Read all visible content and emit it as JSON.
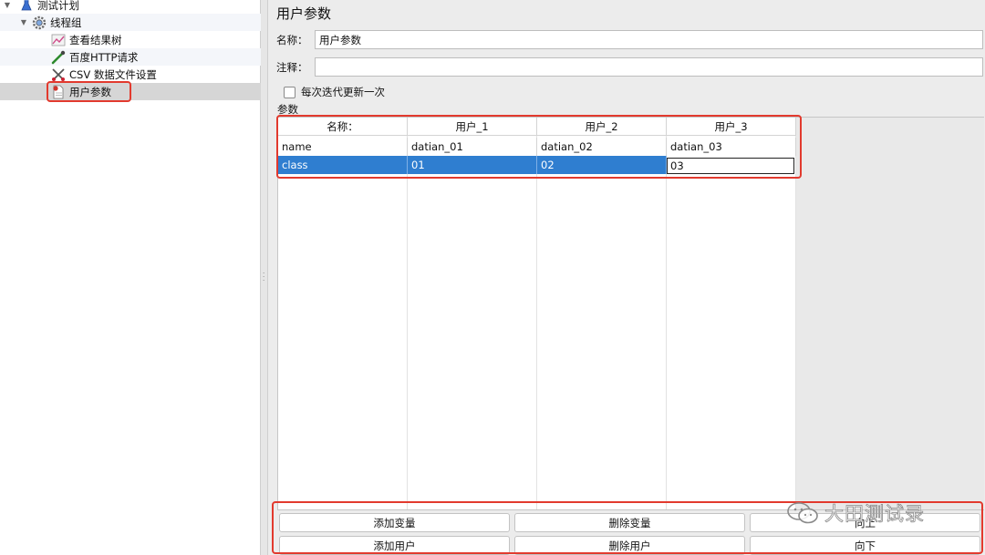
{
  "tree": {
    "items": [
      {
        "label": "测试计划",
        "icon": "flask-icon"
      },
      {
        "label": "线程组",
        "icon": "gear-icon"
      },
      {
        "label": "查看结果树",
        "icon": "chart-icon"
      },
      {
        "label": "百度HTTP请求",
        "icon": "pipette-icon"
      },
      {
        "label": "CSV 数据文件设置",
        "icon": "scissors-icon"
      },
      {
        "label": "用户参数",
        "icon": "document-icon"
      }
    ]
  },
  "form": {
    "title": "用户参数",
    "name_label": "名称：",
    "name_value": "用户参数",
    "comment_label": "注释：",
    "comment_value": "",
    "checkbox_label": "每次迭代更新一次",
    "params_label": "参数"
  },
  "table": {
    "headers": [
      "名称：",
      "用户_1",
      "用户_2",
      "用户_3"
    ],
    "rows": [
      [
        "name",
        "datian_01",
        "datian_02",
        "datian_03"
      ],
      [
        "class",
        "01",
        "02",
        "03"
      ]
    ]
  },
  "buttons": {
    "add_variable": "添加变量",
    "delete_variable": "删除变量",
    "move_up": "向上",
    "add_user": "添加用户",
    "delete_user": "删除用户",
    "move_down": "向下"
  },
  "watermark": "大田测试录",
  "colors": {
    "highlight_box": "#e23a2e",
    "selection": "#2f7ed0"
  }
}
